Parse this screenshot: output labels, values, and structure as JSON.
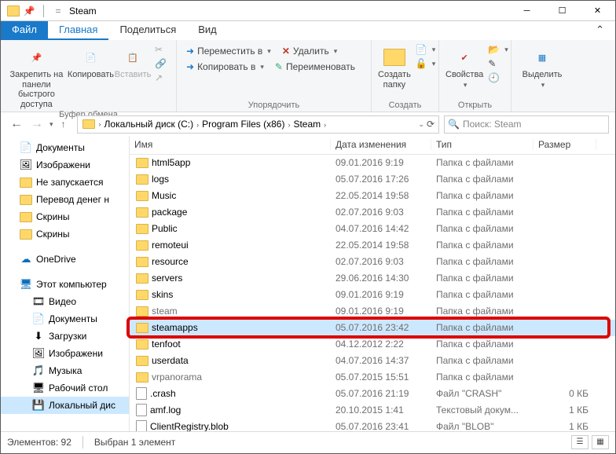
{
  "title": "Steam",
  "menutabs": {
    "file": "Файл",
    "home": "Главная",
    "share": "Поделиться",
    "view": "Вид"
  },
  "ribbon": {
    "g1": {
      "pin": "Закрепить на панели\nбыстрого доступа",
      "copy": "Копировать",
      "paste": "Вставить",
      "label": "Буфер обмена"
    },
    "g2": {
      "move": "Переместить в",
      "copyto": "Копировать в",
      "del": "Удалить",
      "rename": "Переименовать",
      "label": "Упорядочить"
    },
    "g3": {
      "newfolder": "Создать\nпапку",
      "label": "Создать"
    },
    "g4": {
      "props": "Свойства",
      "label": "Открыть"
    },
    "g5": {
      "select": "Выделить",
      "label": ""
    }
  },
  "breadcrumbs": [
    "Локальный диск (C:)",
    "Program Files (x86)",
    "Steam"
  ],
  "search_placeholder": "Поиск: Steam",
  "nav": {
    "quick": [
      {
        "label": "Документы",
        "icon": "doc"
      },
      {
        "label": "Изображени",
        "icon": "pic"
      },
      {
        "label": "Не запускается",
        "icon": "folder"
      },
      {
        "label": "Перевод денег н",
        "icon": "folder"
      },
      {
        "label": "Скрины",
        "icon": "folder"
      },
      {
        "label": "Скрины",
        "icon": "folder"
      }
    ],
    "onedrive": "OneDrive",
    "thispc": "Этот компьютер",
    "thispc_items": [
      {
        "label": "Видео",
        "icon": "vid"
      },
      {
        "label": "Документы",
        "icon": "doc"
      },
      {
        "label": "Загрузки",
        "icon": "dl"
      },
      {
        "label": "Изображени",
        "icon": "pic"
      },
      {
        "label": "Музыка",
        "icon": "mus"
      },
      {
        "label": "Рабочий стол",
        "icon": "desk"
      },
      {
        "label": "Локальный дис",
        "icon": "disk",
        "sel": true
      }
    ]
  },
  "columns": {
    "name": "Имя",
    "date": "Дата изменения",
    "type": "Тип",
    "size": "Размер"
  },
  "rows": [
    {
      "name": "html5app",
      "date": "09.01.2016 9:19",
      "type": "Папка с файлами",
      "size": "",
      "folder": true
    },
    {
      "name": "logs",
      "date": "05.07.2016 17:26",
      "type": "Папка с файлами",
      "size": "",
      "folder": true
    },
    {
      "name": "Music",
      "date": "22.05.2014 19:58",
      "type": "Папка с файлами",
      "size": "",
      "folder": true
    },
    {
      "name": "package",
      "date": "02.07.2016 9:03",
      "type": "Папка с файлами",
      "size": "",
      "folder": true
    },
    {
      "name": "Public",
      "date": "04.07.2016 14:42",
      "type": "Папка с файлами",
      "size": "",
      "folder": true
    },
    {
      "name": "remoteui",
      "date": "22.05.2014 19:58",
      "type": "Папка с файлами",
      "size": "",
      "folder": true
    },
    {
      "name": "resource",
      "date": "02.07.2016 9:03",
      "type": "Папка с файлами",
      "size": "",
      "folder": true
    },
    {
      "name": "servers",
      "date": "29.06.2016 14:30",
      "type": "Папка с файлами",
      "size": "",
      "folder": true
    },
    {
      "name": "skins",
      "date": "09.01.2016 9:19",
      "type": "Папка с файлами",
      "size": "",
      "folder": true
    },
    {
      "name": "steam",
      "date": "09.01.2016 9:19",
      "type": "Папка с файлами",
      "size": "",
      "folder": true,
      "dim": true
    },
    {
      "name": "steamapps",
      "date": "05.07.2016 23:42",
      "type": "Папка с файлами",
      "size": "",
      "folder": true,
      "sel": true
    },
    {
      "name": "tenfoot",
      "date": "04.12.2012 2:22",
      "type": "Папка с файлами",
      "size": "",
      "folder": true
    },
    {
      "name": "userdata",
      "date": "04.07.2016 14:37",
      "type": "Папка с файлами",
      "size": "",
      "folder": true
    },
    {
      "name": "vrpanorama",
      "date": "05.07.2015 15:51",
      "type": "Папка с файлами",
      "size": "",
      "folder": true,
      "dim": true
    },
    {
      "name": ".crash",
      "date": "05.07.2016 21:19",
      "type": "Файл \"CRASH\"",
      "size": "0 КБ",
      "folder": false
    },
    {
      "name": "amf.log",
      "date": "20.10.2015 1:41",
      "type": "Текстовый докум...",
      "size": "1 КБ",
      "folder": false
    },
    {
      "name": "ClientRegistry.blob",
      "date": "05.07.2016 23:41",
      "type": "Файл \"BLOB\"",
      "size": "1 КБ",
      "folder": false
    }
  ],
  "status": {
    "count": "Элементов: 92",
    "selection": "Выбран 1 элемент"
  },
  "highlight_row_index": 10
}
